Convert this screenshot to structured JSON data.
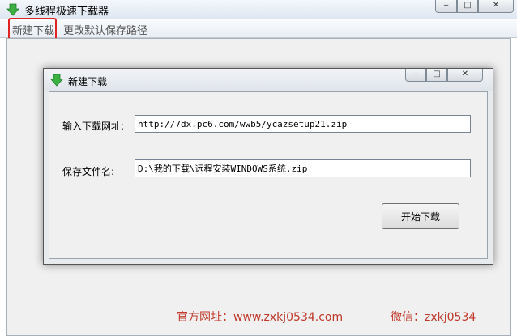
{
  "window": {
    "title": "多线程极速下载器",
    "controls": {
      "minimize": "‒",
      "maximize": "□",
      "close": "✕"
    }
  },
  "menu": {
    "items": [
      {
        "label": "新建下载"
      },
      {
        "label": "更改默认保存路径"
      }
    ]
  },
  "dialog": {
    "title": "新建下载",
    "controls": {
      "minimize": "‒",
      "maximize": "□",
      "close": "✕"
    },
    "url_label": "输入下载网址:",
    "url_value": "http://7dx.pc6.com/wwb5/ycazsetup21.zip",
    "filename_label": "保存文件名:",
    "filename_value": "D:\\我的下载\\远程安装WINDOWS系统.zip",
    "start_button": "开始下载"
  },
  "footer": {
    "website": "官方网址：www.zxkj0534.com",
    "wechat": "微信：zxkj0534"
  },
  "colors": {
    "accent_red": "#e02424",
    "footer_text": "#c0392b",
    "icon_green": "#3cb043"
  },
  "icons": {
    "app": "green-down-arrow-icon"
  }
}
